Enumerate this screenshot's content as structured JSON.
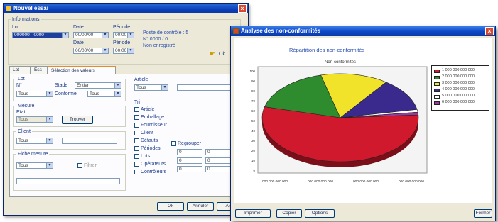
{
  "left_window": {
    "title": "Nouvel essai",
    "top_group_label": "Informations",
    "field_label_a": "Lot",
    "field_value_a": "000000 - 0000",
    "label_date_a": "Date",
    "label_date_b": "Date",
    "label_etat": "Période",
    "label_etat_b": "Période",
    "date_a": "00/00/00",
    "date_b": "00/00/00",
    "time_a": "00:00",
    "time_b": "00:00",
    "info_line_1": "Poste de contrôle : 5",
    "info_line_2": "N° 0000 / 0",
    "info_line_3": "Non enregistré",
    "side_button": "Ok",
    "tabs": [
      "Lot",
      "Ess",
      "Sélection des valeurs"
    ],
    "group_lot": "Lot",
    "lot_label": "N°",
    "lot_combo": "Stade",
    "lot_combo2": "Entier",
    "lot_value": "Tous",
    "lot_option": "Conforme",
    "lot_option2": "Tous",
    "group_right_label": "Article",
    "article_value": "Tous",
    "group_mesure": "Mesure",
    "mesure_sub": "Etat",
    "mesure_value": "Tous",
    "mesure_button": "Trouver",
    "group_client": "Client",
    "client_value": "Tous",
    "group_fiche": "Fiche mesure",
    "fiche_value": "Tous",
    "fiche_checkbox": "Filtrer",
    "checklist_title": "Tri",
    "checklist": [
      "Article",
      "Emballage",
      "Fournisseur",
      "Client",
      "Défauts",
      "Périodes",
      "Lots",
      "Opérateurs",
      "Contrôleurs"
    ],
    "checklist_extra": "Regrouper",
    "grid_values": [
      "0",
      "0",
      "0",
      "0",
      "0",
      "0"
    ],
    "bottom_buttons": [
      "Ok",
      "Annuler",
      "Aide"
    ]
  },
  "right_window": {
    "title": "Analyse des non-conformités",
    "chart_title": "Répartition des non-conformités",
    "inner_title": "Non-conformités",
    "bottom_buttons": [
      "Imprimer",
      "Copier",
      "Options"
    ],
    "close_button": "Fermer",
    "x_ticks": [
      "000 000 000 000",
      "000 000 000 000",
      "000 000 000 000",
      "000 000 000 000"
    ],
    "y_ticks": [
      "100",
      "90",
      "80",
      "70",
      "60",
      "50",
      "40",
      "30",
      "20",
      "10",
      "0"
    ]
  },
  "chart_data": {
    "type": "pie",
    "title": "Répartition des non-conformités",
    "series": [
      {
        "name": "1 000 000 000 000",
        "value": 55,
        "color": "#d0192d"
      },
      {
        "name": "2 000 000 000 000",
        "value": 17,
        "color": "#2e8b2e"
      },
      {
        "name": "3 000 000 000 000",
        "value": 14,
        "color": "#f1e22a"
      },
      {
        "name": "4 000 000 000 000",
        "value": 12,
        "color": "#3a2a8e"
      },
      {
        "name": "5 000 000 000 000",
        "value": 1,
        "color": "#ffffff"
      },
      {
        "name": "6 000 000 000 000",
        "value": 1,
        "color": "#9b3a9b"
      }
    ],
    "legend": "right"
  },
  "colors": {
    "titlebar": "#0a3fb8",
    "window_bg": "#ece9d8",
    "close": "#d8462b"
  }
}
